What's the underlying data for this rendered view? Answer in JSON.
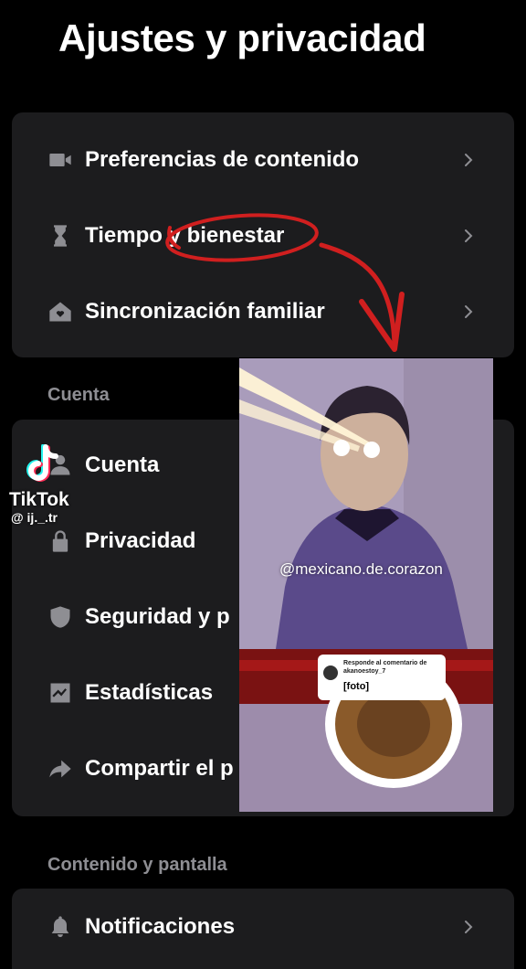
{
  "header": {
    "title": "Ajustes y privacidad"
  },
  "group1": {
    "items": [
      {
        "label": "Preferencias de contenido",
        "icon": "video-camera-icon"
      },
      {
        "label": "Tiempo y bienestar",
        "icon": "hourglass-icon"
      },
      {
        "label": "Sincronización familiar",
        "icon": "home-heart-icon"
      }
    ]
  },
  "account_section": {
    "title": "Cuenta",
    "items": [
      {
        "label": "Cuenta",
        "icon": "person-icon"
      },
      {
        "label": "Privacidad",
        "icon": "lock-icon"
      },
      {
        "label": "Seguridad y p",
        "icon": "shield-icon"
      },
      {
        "label": "Estadísticas",
        "icon": "chart-icon"
      },
      {
        "label": "Compartir el p",
        "icon": "share-icon"
      }
    ]
  },
  "content_section": {
    "title": "Contenido y pantalla",
    "items": [
      {
        "label": "Notificaciones",
        "icon": "bell-icon"
      }
    ]
  },
  "watermark": {
    "brand": "TikTok",
    "username": "@ ij._.tr"
  },
  "video_overlay": {
    "handle": "@mexicano.de.corazon",
    "comment_header": "Responde al comentario de akanoestoy_7",
    "comment_text": "[foto]"
  },
  "colors": {
    "background": "#000000",
    "card": "#1c1c1e",
    "secondary_text": "#8e8e93",
    "annotation": "#d01f1f"
  }
}
